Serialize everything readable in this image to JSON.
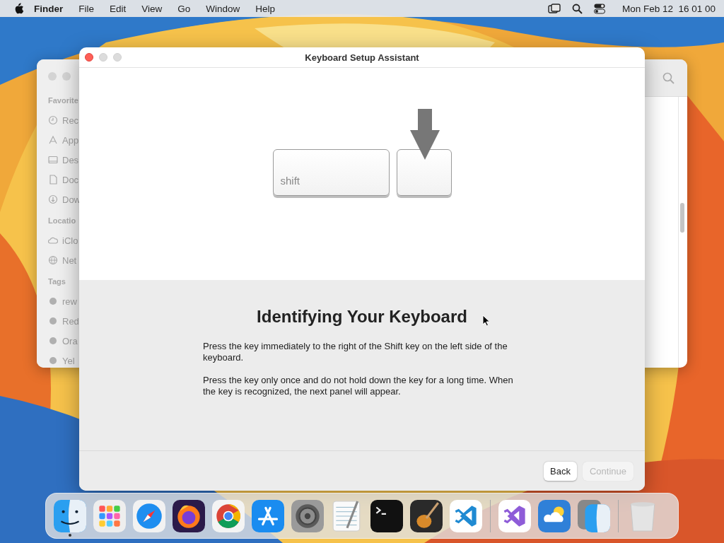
{
  "menu_bar": {
    "app_name": "Finder",
    "items": [
      "File",
      "Edit",
      "View",
      "Go",
      "Window",
      "Help"
    ],
    "clock": "Mon Feb 12  16 01 00"
  },
  "finder_window": {
    "sidebar": [
      {
        "heading": "Favorite",
        "items": [
          "Rec",
          "App",
          "Des",
          "Doc",
          "Dow"
        ]
      },
      {
        "heading": "Locatio",
        "items": [
          "iClo",
          "Net"
        ]
      },
      {
        "heading": "Tags",
        "items": [
          "rew",
          "Red",
          "Ora",
          "Yel"
        ]
      }
    ]
  },
  "dialog": {
    "title": "Keyboard Setup Assistant",
    "key_label": "shift",
    "heading": "Identifying Your Keyboard",
    "paragraphs": [
      "Press the key immediately to the right of the Shift key on the left side of the keyboard.",
      "Press the key only once and do not hold down the key for a long time. When the key is recognized, the next panel will appear."
    ],
    "buttons": [
      {
        "label": "Back",
        "disabled": false
      },
      {
        "label": "Continue",
        "disabled": true
      }
    ]
  },
  "dock": [
    {
      "running": true
    },
    {
      "running": false
    },
    {
      "running": false
    },
    {
      "running": false
    },
    {
      "running": false
    },
    {
      "running": false
    },
    {
      "running": false
    },
    {
      "running": false
    },
    {
      "running": false
    },
    {
      "running": false
    },
    {
      "running": false
    },
    {
      "running": false
    },
    {
      "running": false
    },
    {
      "running": false
    },
    {
      "running": false
    }
  ]
}
